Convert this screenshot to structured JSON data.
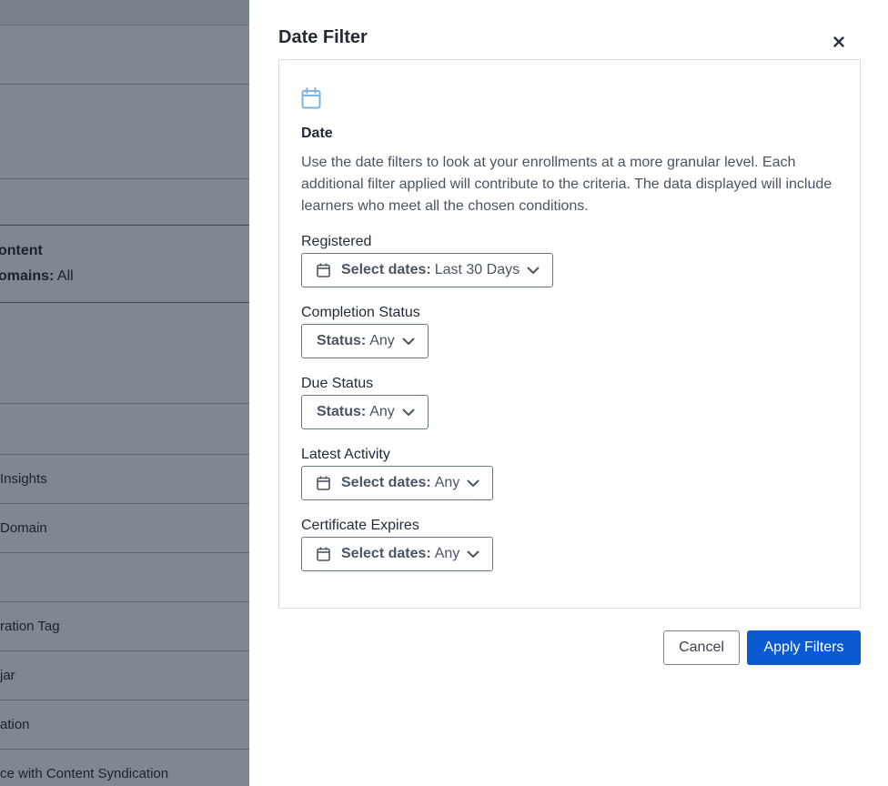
{
  "background": {
    "content_label": "ontent",
    "domains_label": "omains:",
    "domains_value": "All",
    "rows": [
      " Insights",
      "Domain",
      "ration Tag",
      "jar",
      "ation",
      "ce with Content Syndication"
    ]
  },
  "drawer": {
    "title": "Date Filter",
    "close_icon": "close-icon",
    "panel": {
      "icon": "calendar-icon",
      "heading": "Date",
      "description": "Use the date filters to look at your enrollments at a more granular level. Each additional filter applied will contribute to the criteria. The data displayed will include learners who meet all the chosen conditions."
    },
    "filters": [
      {
        "label": "Registered",
        "key": "Select dates:",
        "value": "Last 30 Days",
        "icon": "calendar-icon"
      },
      {
        "label": "Completion Status",
        "key": "Status:",
        "value": "Any"
      },
      {
        "label": "Due Status",
        "key": "Status:",
        "value": "Any"
      },
      {
        "label": "Latest Activity",
        "key": "Select dates:",
        "value": "Any",
        "icon": "calendar-icon"
      },
      {
        "label": "Certificate Expires",
        "key": "Select dates:",
        "value": "Any",
        "icon": "calendar-icon"
      }
    ],
    "buttons": {
      "cancel": "Cancel",
      "apply": "Apply Filters"
    }
  },
  "colors": {
    "overlay": "#7f8791",
    "primary": "#0a5bd3",
    "calendar_icon": "#7fb2e5",
    "border": "#d8dde3"
  }
}
